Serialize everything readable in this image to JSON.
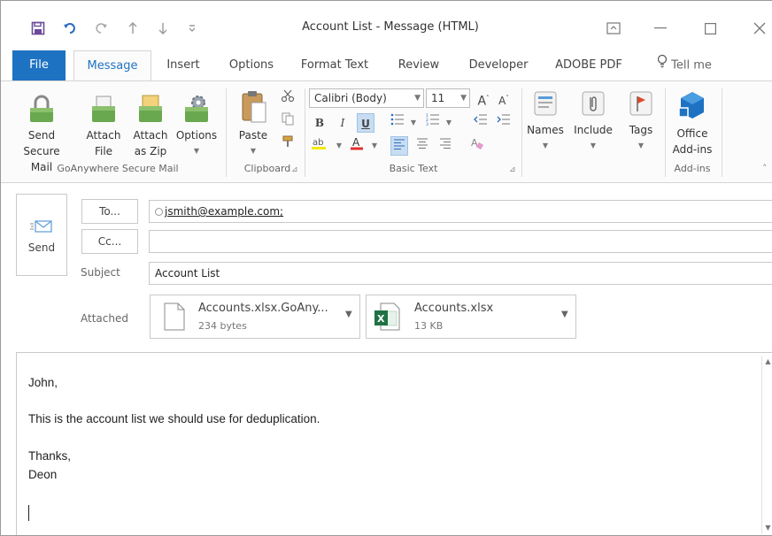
{
  "window": {
    "title": "Account List  -  Message (HTML)"
  },
  "tabs": [
    {
      "label": "File"
    },
    {
      "label": "Message"
    },
    {
      "label": "Insert"
    },
    {
      "label": "Options"
    },
    {
      "label": "Format Text"
    },
    {
      "label": "Review"
    },
    {
      "label": "Developer"
    },
    {
      "label": "ADOBE PDF"
    },
    {
      "label": "Tell me"
    }
  ],
  "ribbon": {
    "secure_mail": {
      "group_label": "GoAnywhere Secure Mail",
      "send_line1": "Send",
      "send_line2": "Secure Mail",
      "attach_file_line1": "Attach",
      "attach_file_line2": "File",
      "attach_zip_line1": "Attach",
      "attach_zip_line2": "as Zip",
      "options_label": "Options"
    },
    "clipboard": {
      "group_label": "Clipboard",
      "paste_label": "Paste"
    },
    "basic_text": {
      "group_label": "Basic Text",
      "font_name": "Calibri (Body)",
      "font_size": "11",
      "bold": "B",
      "italic": "I",
      "underline": "U"
    },
    "names_label": "Names",
    "include_label": "Include",
    "tags_label": "Tags",
    "addins": {
      "group_label": "Add-ins",
      "office_line1": "Office",
      "office_line2": "Add-ins"
    }
  },
  "compose": {
    "send_label": "Send",
    "to_button": "To...",
    "cc_button": "Cc...",
    "to_value": "jsmith@example.com;",
    "cc_value": "",
    "subject_label": "Subject",
    "subject_value": "Account List",
    "attached_label": "Attached",
    "attachments": [
      {
        "name": "Accounts.xlsx.GoAny...",
        "size": "234 bytes"
      },
      {
        "name": "Accounts.xlsx",
        "size": "13 KB"
      }
    ]
  },
  "body": {
    "greeting": "John,",
    "line1": "This is the account list we should use for deduplication.",
    "signoff": "Thanks,",
    "signature": "Deon"
  },
  "colors": {
    "accent": "#1e72c2",
    "excel_green": "#1f7244",
    "attach_green": "#6aa84f"
  }
}
